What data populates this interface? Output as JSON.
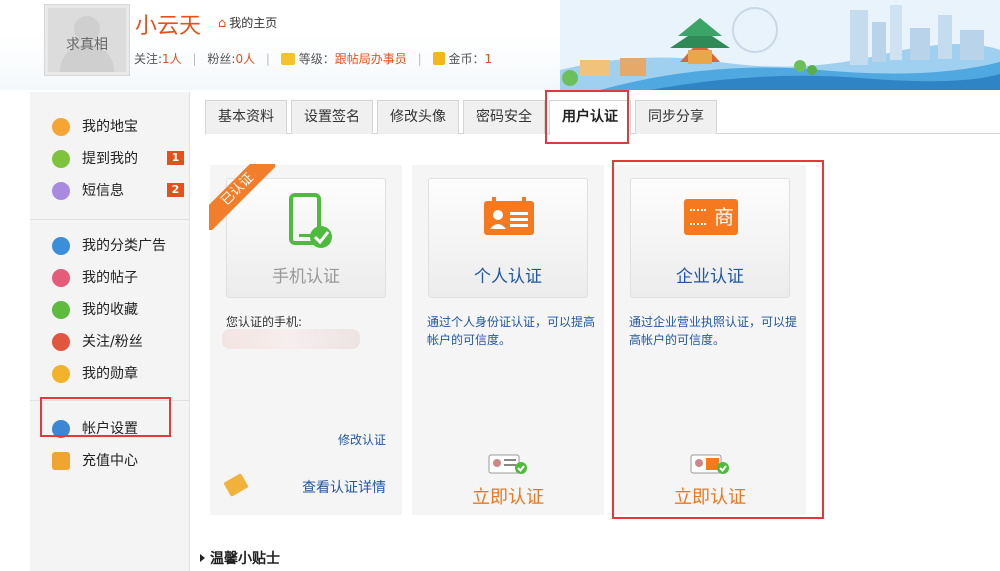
{
  "header": {
    "avatar_text": "求真相",
    "username": "小云天",
    "home_link": "我的主页",
    "follow_label": "关注:",
    "follow_count": "1人",
    "fans_label": "粉丝:",
    "fans_count": "0人",
    "level_label": "等级：",
    "level_value": "跟帖局办事员",
    "coin_label": "金币：",
    "coin_value": "1"
  },
  "sidebar": {
    "items": [
      {
        "label": "我的地宝",
        "icon": "home-icon"
      },
      {
        "label": "提到我的",
        "icon": "at-icon",
        "badge": "1"
      },
      {
        "label": "短信息",
        "icon": "mail-icon",
        "badge": "2"
      },
      {
        "label": "我的分类广告",
        "icon": "list-icon"
      },
      {
        "label": "我的帖子",
        "icon": "post-icon"
      },
      {
        "label": "我的收藏",
        "icon": "star-icon"
      },
      {
        "label": "关注/粉丝",
        "icon": "users-icon"
      },
      {
        "label": "我的勋章",
        "icon": "medal-icon"
      },
      {
        "label": "帐户设置",
        "icon": "gear-icon"
      },
      {
        "label": "充值中心",
        "icon": "wallet-icon"
      }
    ]
  },
  "tabs": [
    {
      "label": "基本资料"
    },
    {
      "label": "设置签名"
    },
    {
      "label": "修改头像"
    },
    {
      "label": "密码安全"
    },
    {
      "label": "用户认证"
    },
    {
      "label": "同步分享"
    }
  ],
  "cards": {
    "phone": {
      "ribbon": "已认证",
      "title": "手机认证",
      "phone_label": "您认证的手机:",
      "modify_link": "修改认证",
      "detail_link": "查看认证详情"
    },
    "personal": {
      "title": "个人认证",
      "desc": "通过个人身份证认证，可以提高帐户的可信度。",
      "button": "立即认证"
    },
    "enterprise": {
      "title": "企业认证",
      "icon_char": "商",
      "desc": "通过企业营业执照认证，可以提高帐户的可信度。",
      "button": "立即认证"
    }
  },
  "tips_title": "温馨小贴士",
  "colors": {
    "accent": "#e8501a",
    "link": "#1f57a8",
    "button": "#f0761e",
    "highlight": "#e23a3a",
    "verified_green": "#4dbb3c"
  }
}
